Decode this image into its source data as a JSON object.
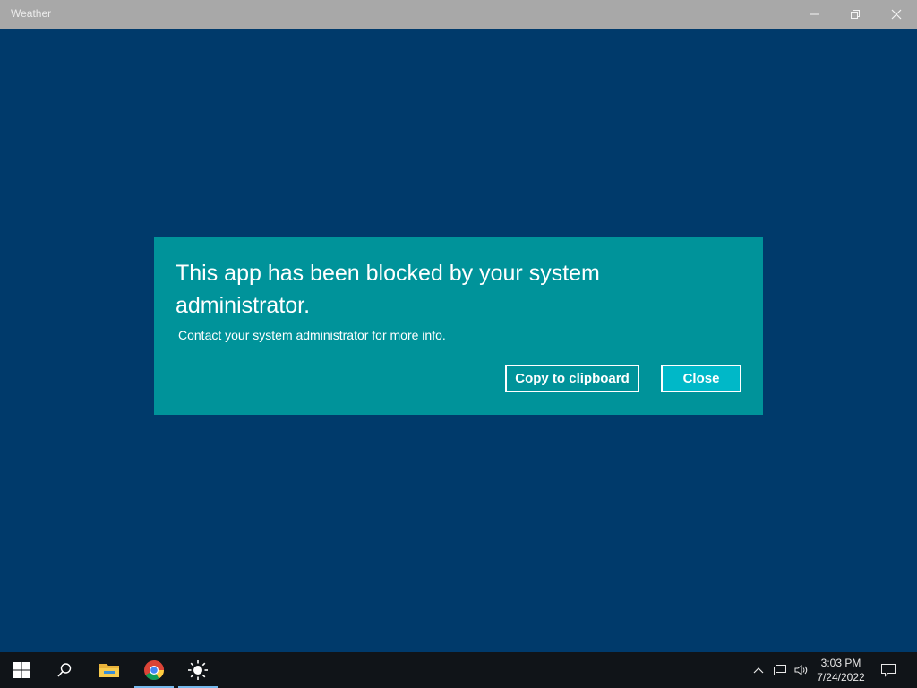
{
  "window": {
    "title": "Weather",
    "controls": {
      "minimize": "minimize-icon",
      "restore": "restore-icon",
      "close": "close-icon"
    }
  },
  "dialog": {
    "heading": "This app has been blocked by your system administrator.",
    "message": "Contact your system administrator for more info.",
    "copy_label": "Copy to clipboard",
    "close_label": "Close",
    "background": "#00939a",
    "close_button_color": "#00b8c8"
  },
  "taskbar": {
    "items": [
      "windows-start-icon",
      "search-icon",
      "file-explorer-icon",
      "chrome-icon",
      "weather-sun-icon"
    ],
    "tray": [
      "chevron-up-icon",
      "network-icon",
      "volume-icon"
    ],
    "time": "3:03 PM",
    "date": "7/24/2022",
    "notification_icon": "action-center-icon"
  },
  "colors": {
    "app_background": "#003a6b",
    "taskbar": "#101418",
    "titlebar": "#a8a8a8"
  }
}
